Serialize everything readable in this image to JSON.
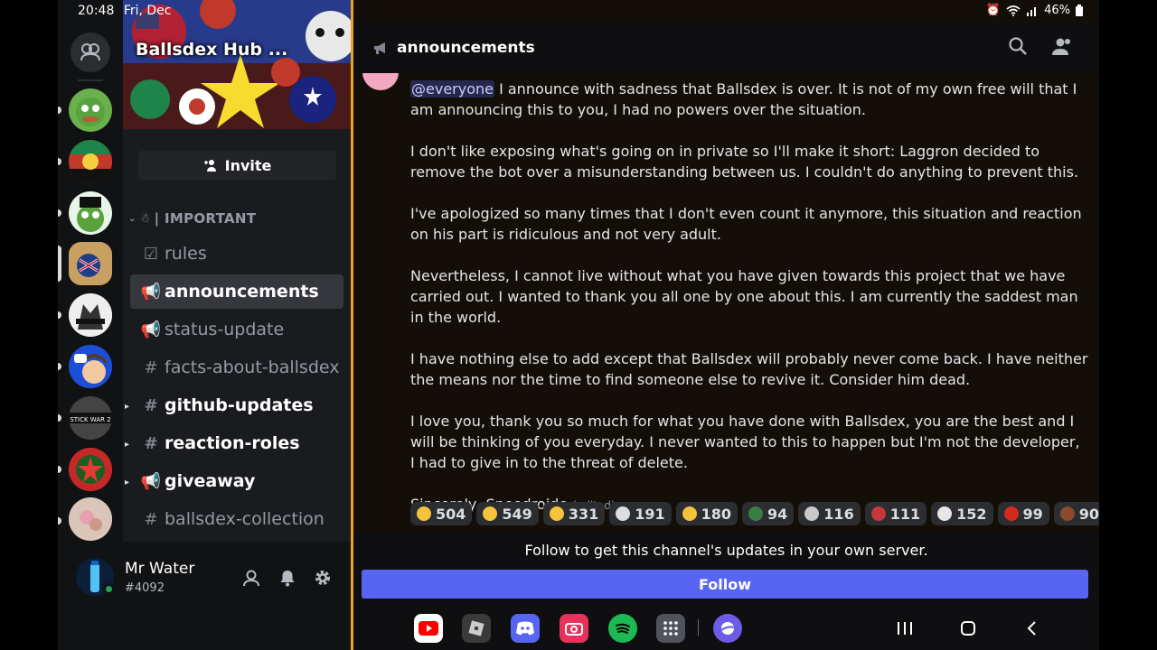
{
  "status_bar": {
    "time": "20:48",
    "date": "Fri, Dec",
    "battery": "46%"
  },
  "server": {
    "name": "Ballsdex Hub ..."
  },
  "invite_label": "Invite",
  "category": {
    "name": "| IMPORTANT"
  },
  "channels": [
    {
      "name": "rules",
      "icon": "rules-check-icon"
    },
    {
      "name": "announcements",
      "icon": "megaphone-icon"
    },
    {
      "name": "status-update",
      "icon": "megaphone-icon"
    },
    {
      "name": "facts-about-ballsdex",
      "icon": "hash-icon"
    },
    {
      "name": "github-updates",
      "icon": "hash-icon"
    },
    {
      "name": "reaction-roles",
      "icon": "hash-icon"
    },
    {
      "name": "giveaway",
      "icon": "megaphone-icon"
    },
    {
      "name": "ballsdex-collection",
      "icon": "hash-icon"
    }
  ],
  "user": {
    "name": "Mr Water",
    "tag": "#4092"
  },
  "header": {
    "channel": "announcements"
  },
  "message": {
    "mention": "@everyone",
    "p1": " I announce with sadness that Ballsdex is over. It is not of my own free will that I am announcing this to you, I had no powers over the situation.",
    "p2": "I don't like exposing what's going on in private so I'll make it short: Laggron decided to remove the bot over a misunderstanding between us. I couldn't do anything to prevent this.",
    "p3": "I've apologized so many times that I don't even count it anymore, this situation and reaction on his part is ridiculous and not very adult.",
    "p4": "Nevertheless, I cannot live without what you have given towards this project that we have carried out. I wanted to thank you all one by one about this. I am currently the saddest man in the world.",
    "p5": "I have nothing else to add except that Ballsdex will probably never come back. I have neither the means nor the time to find someone else to revive it. Consider him dead.",
    "p6": "I love you, thank you so much for what you have done with Ballsdex, you are the best and I will be thinking of you everyday. I never wanted to this to happen but I'm not the developer, I had to give in to the threat of delete.",
    "signature": "Sincerely, Speedroide",
    "edited": "(edited)"
  },
  "reactions": [
    {
      "count": "504",
      "color": "#f5c33b"
    },
    {
      "count": "549",
      "color": "#f5c33b"
    },
    {
      "count": "331",
      "color": "#f5c33b"
    },
    {
      "count": "191",
      "color": "#dcddde"
    },
    {
      "count": "180",
      "color": "#f5c33b"
    },
    {
      "count": "94",
      "color": "#3a7d44"
    },
    {
      "count": "116",
      "color": "#c9c9c9"
    },
    {
      "count": "111",
      "color": "#c6363c"
    },
    {
      "count": "152",
      "color": "#e6e6e6"
    },
    {
      "count": "99",
      "color": "#d52b1e"
    },
    {
      "count": "90",
      "color": "#8b4a2b"
    }
  ],
  "follow": {
    "prompt": "Follow to get this channel's updates in your own server.",
    "button": "Follow"
  }
}
